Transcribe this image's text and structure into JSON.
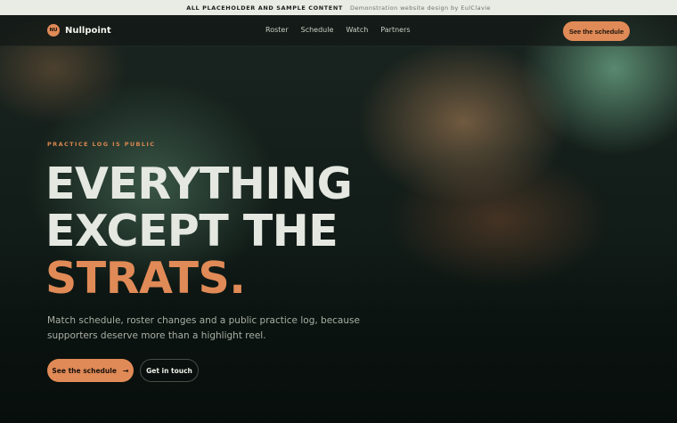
{
  "topbar": {
    "notice": "ALL PLACEHOLDER AND SAMPLE CONTENT",
    "credit": "Demonstration website design by EulClavie"
  },
  "nav": {
    "logo_badge": "NU",
    "brand": "Nullpoint",
    "links": [
      "Roster",
      "Schedule",
      "Watch",
      "Partners"
    ],
    "cta": "See the schedule"
  },
  "hero": {
    "eyebrow": "PRACTICE LOG IS PUBLIC",
    "headline_line1": "EVERYTHING",
    "headline_line2": "EXCEPT THE",
    "headline_accent": "STRATS.",
    "lede": "Match schedule, roster changes and a public practice log, because supporters deserve more than a highlight reel.",
    "primary_button": "See the schedule",
    "primary_icon": "arrow-right-icon",
    "secondary_button": "Get in touch"
  },
  "colors": {
    "accent": "#e08a57",
    "background": "#0b1512",
    "topbar": "#e9ece4"
  }
}
